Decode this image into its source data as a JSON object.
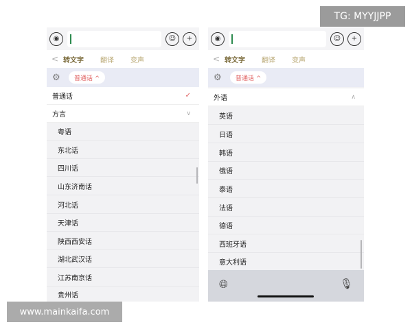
{
  "left": {
    "tabs": {
      "back": "<",
      "transcribe": "转文字",
      "translate": "翻译",
      "voice": "变声"
    },
    "language_pill": "普通话 ^",
    "rows": {
      "mandarin": "普通话",
      "dialect": "方言"
    },
    "dialects": [
      "粤语",
      "东北话",
      "四川话",
      "山东济南话",
      "河北话",
      "天津话",
      "陕西西安话",
      "湖北武汉话",
      "江苏南京话",
      "贵州话"
    ],
    "icons": {
      "voice_input": "voice-wave-icon",
      "emoji": "emoji-icon",
      "add": "plus-icon",
      "settings": "gear-icon",
      "check": "checkmark-icon",
      "collapse": "chevron-down-icon"
    }
  },
  "right": {
    "tabs": {
      "back": "<",
      "transcribe": "转文字",
      "translate": "翻译",
      "voice": "变声"
    },
    "language_pill": "普通话 ^",
    "section": "外语",
    "languages": [
      "英语",
      "日语",
      "韩语",
      "俄语",
      "泰语",
      "法语",
      "德语",
      "西班牙语",
      "意大利语"
    ],
    "icons": {
      "globe": "globe-icon",
      "mic": "microphone-icon",
      "expand": "chevron-up-icon"
    }
  },
  "watermarks": {
    "tg": "TG: MYYJJPP",
    "site": "www.mainkaifa.com"
  },
  "colors": {
    "accent_red": "#e06262",
    "tab_gold": "#b9a874",
    "caret_green": "#2c8a4e"
  }
}
